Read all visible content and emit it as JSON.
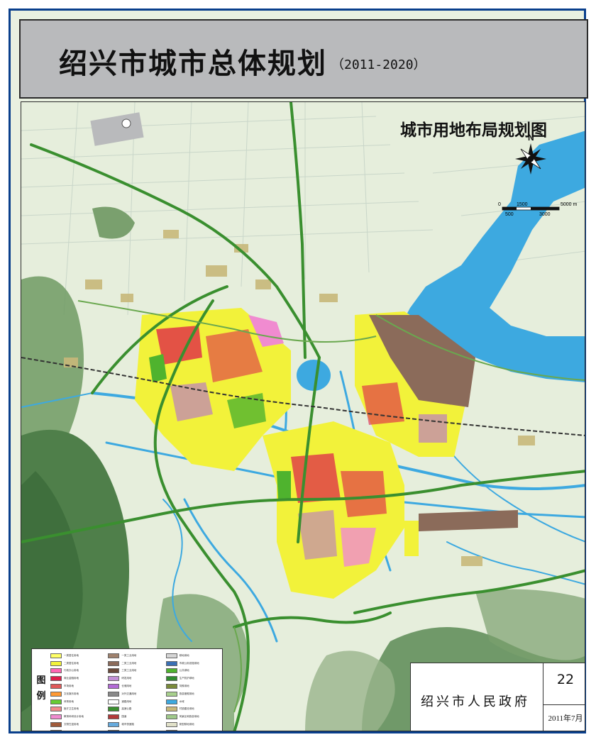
{
  "header": {
    "title": "绍兴市城市总体规划",
    "years": "（2011-2020）"
  },
  "map": {
    "subtitle": "城市用地布局规划图",
    "compass_label": "N",
    "scale_labels_top": [
      "0",
      "1500",
      "5000 m"
    ],
    "scale_labels_bottom": [
      "500",
      "3000"
    ],
    "colors": {
      "water": "#3da9e0",
      "background": "#e9f0e0",
      "residential": "#f2f23a",
      "commercial": "#dd1c4a",
      "industrial": "#8b6b5a",
      "green": "#4f9b2e",
      "mountain": "#2f6b3a",
      "highway": "#3a8f2f",
      "purple": "#b36bd6",
      "pink": "#f08bd0"
    }
  },
  "legend": {
    "heading": "图例",
    "items": [
      {
        "label": "一类居住用地",
        "color": "#ffff66"
      },
      {
        "label": "一类工业用地",
        "color": "#a0826e"
      },
      {
        "label": "耕地用地",
        "color": "#d5d5d5"
      },
      {
        "label": "二类居住用地",
        "color": "#f2f23a"
      },
      {
        "label": "二类工业用地",
        "color": "#8b6b5a"
      },
      {
        "label": "市政公用设施用地",
        "color": "#3a6fb3"
      },
      {
        "label": "行政办公用地",
        "color": "#ff66b3"
      },
      {
        "label": "三类工业用地",
        "color": "#6b4a3a"
      },
      {
        "label": "公共绿地",
        "color": "#4fb32e"
      },
      {
        "label": "商业金融用地",
        "color": "#dd1c4a"
      },
      {
        "label": "研发用地",
        "color": "#c390d6"
      },
      {
        "label": "生产防护绿地",
        "color": "#2f8b2f"
      },
      {
        "label": "市场用地",
        "color": "#e05a5a"
      },
      {
        "label": "仓储用地",
        "color": "#b36bd6"
      },
      {
        "label": "特殊用地",
        "color": "#7a8a3a"
      },
      {
        "label": "文化娱乐用地",
        "color": "#ff9933"
      },
      {
        "label": "对外交通用地",
        "color": "#8a8a8a"
      },
      {
        "label": "旅游度假用地",
        "color": "#a8d08d"
      },
      {
        "label": "体育用地",
        "color": "#66cc33"
      },
      {
        "label": "道路用地",
        "color": "#ffffff"
      },
      {
        "label": "水域",
        "color": "#3da9e0"
      },
      {
        "label": "医疗卫生用地",
        "color": "#f08b8b"
      },
      {
        "label": "高速公路",
        "color": "#3a8f2f"
      },
      {
        "label": "村镇建设用地",
        "color": "#c8b87a"
      },
      {
        "label": "教育科研设计用地",
        "color": "#f08bd0"
      },
      {
        "label": "国道",
        "color": "#b33a3a"
      },
      {
        "label": "风景区和旅游用地",
        "color": "#9fc98a"
      },
      {
        "label": "文物古迹用地",
        "color": "#a05a3a"
      },
      {
        "label": "城市快速路",
        "color": "#66aadd"
      },
      {
        "label": "新型耕地用地",
        "color": "#e0e0c8"
      },
      {
        "label": "其它公共设施用地",
        "color": "#d98ab0"
      },
      {
        "label": "铁路",
        "color": "#444444"
      },
      {
        "label": "中心城市规划建设用地范围",
        "color": "#ffffff"
      }
    ]
  },
  "stamp": {
    "org": "绍兴市人民政府",
    "sheet_no": "22",
    "date": "2011年7月"
  }
}
